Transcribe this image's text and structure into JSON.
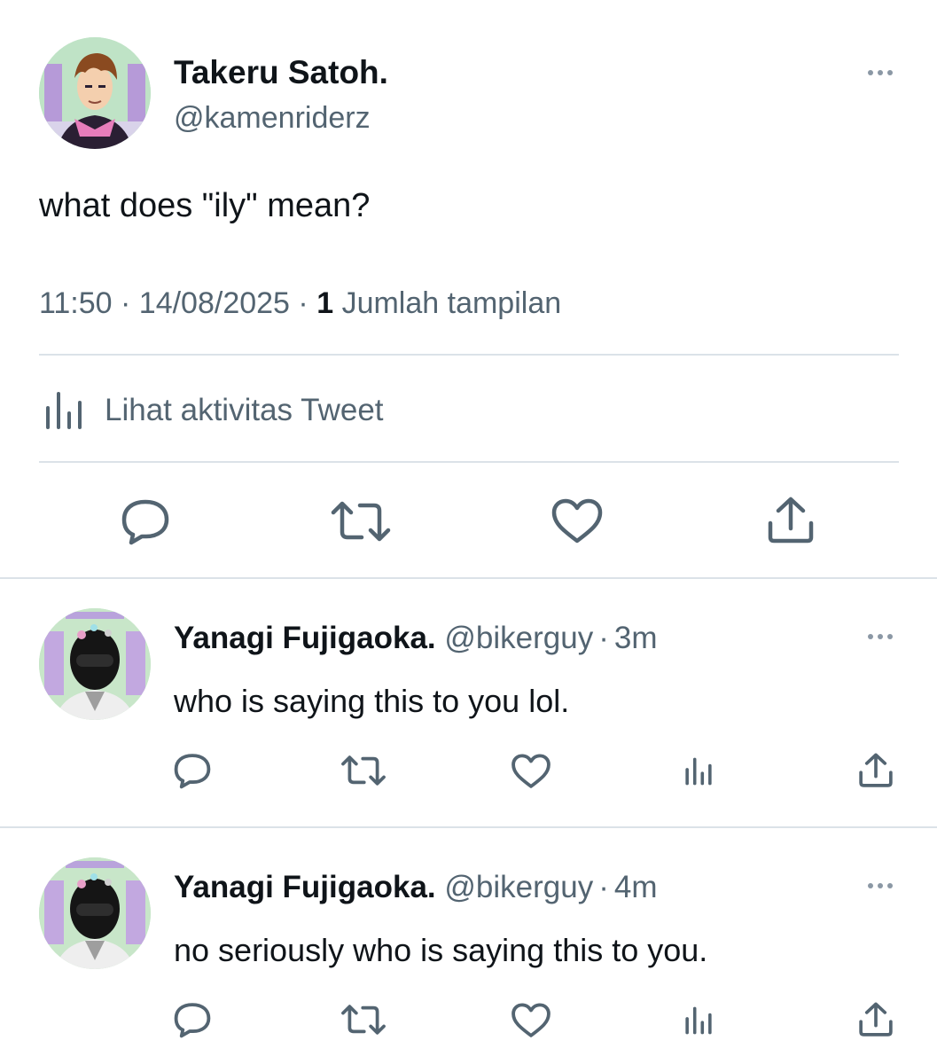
{
  "main_tweet": {
    "display_name": "Takeru Satoh.",
    "handle": "@kamenriderz",
    "text": "what does \"ily\" mean?",
    "time": "11:50",
    "date": "14/08/2025",
    "separator": "·",
    "view_count": "1",
    "views_label": "Jumlah tampilan",
    "activity_label": "Lihat aktivitas Tweet",
    "avatar_icon": "avatar-takeru-icon"
  },
  "replies": [
    {
      "display_name": "Yanagi Fujigaoka.",
      "handle": "@bikerguy",
      "separator": "·",
      "age": "3m",
      "text": "who is saying this to you lol.",
      "avatar_icon": "avatar-yanagi-icon"
    },
    {
      "display_name": "Yanagi Fujigaoka.",
      "handle": "@bikerguy",
      "separator": "·",
      "age": "4m",
      "text": "no seriously who is saying this to you.",
      "avatar_icon": "avatar-yanagi-icon"
    }
  ],
  "icons": {
    "reply": "reply-icon",
    "retweet": "retweet-icon",
    "like": "like-icon",
    "share": "share-icon",
    "analytics": "analytics-icon",
    "more": "more-icon"
  },
  "colors": {
    "text": "#0f1419",
    "muted": "#536471",
    "divider": "#dbe2e8",
    "icon": "#536471"
  }
}
